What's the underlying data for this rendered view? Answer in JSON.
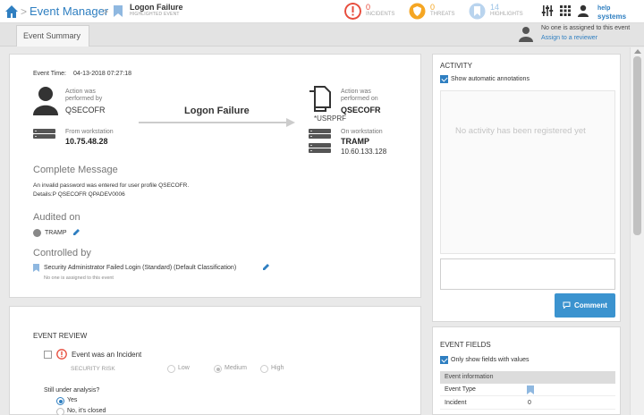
{
  "header": {
    "app_title": "Event Manager",
    "event_title": "Logon Failure",
    "event_subtitle": "HIGHLIGHTED EVENT",
    "stats": [
      {
        "count": "0",
        "label": "INCIDENTS",
        "color": "#e74c3c"
      },
      {
        "count": "0",
        "label": "THREATS",
        "color": "#f5a623"
      },
      {
        "count": "14",
        "label": "HIGHLIGHTS",
        "color": "#9cc3e6"
      }
    ],
    "logo_line1": "help",
    "logo_line2": "systems"
  },
  "tabs": {
    "active": "Event Summary"
  },
  "assignment": {
    "text": "No one is assigned to this event",
    "link": "Assign to a reviewer"
  },
  "summary": {
    "event_time_label": "Event Time:",
    "event_time_value": "04-13-2018 07:27:18",
    "performed_by_label": "Action was performed by",
    "performed_by_value": "QSECOFR",
    "from_ws_label": "From workstation",
    "from_ws_value": "10.75.48.28",
    "action_name": "Logon Failure",
    "performed_on_label": "Action was performed on",
    "performed_on_value": "QSECOFR",
    "performed_on_sub": "*USRPRF",
    "on_ws_label": "On workstation",
    "on_ws_value": "TRAMP",
    "on_ws_ip": "10.60.133.128",
    "complete_message_title": "Complete Message",
    "complete_message_line1": "An invalid password was entered for user profile QSECOFR.",
    "complete_message_line2": "Details:P QSECOFR QPADEV0006",
    "audited_on_title": "Audited on",
    "audited_on_value": "TRAMP",
    "controlled_by_title": "Controlled by",
    "controlled_by_value": "Security Administrator Failed Login (Standard) (Default Classification)",
    "controlled_by_note": "No one is assigned to this event"
  },
  "review": {
    "title": "EVENT REVIEW",
    "incident_label": "Event was an Incident",
    "security_risk_label": "SECURITY RISK",
    "risk_options": [
      "Low",
      "Medium",
      "High"
    ],
    "risk_selected": "Medium",
    "analysis_question": "Still under analysis?",
    "analysis_options": [
      "Yes",
      "No, it's closed"
    ],
    "analysis_selected": "Yes"
  },
  "activity": {
    "title": "ACTIVITY",
    "show_auto_label": "Show automatic annotations",
    "empty_text": "No activity has been registered yet",
    "comment_button": "Comment"
  },
  "event_fields": {
    "title": "EVENT FIELDS",
    "only_values_label": "Only show fields with values",
    "section_header": "Event information",
    "rows": [
      {
        "name": "Event Type",
        "value": ""
      },
      {
        "name": "Incident",
        "value": "0"
      }
    ]
  }
}
